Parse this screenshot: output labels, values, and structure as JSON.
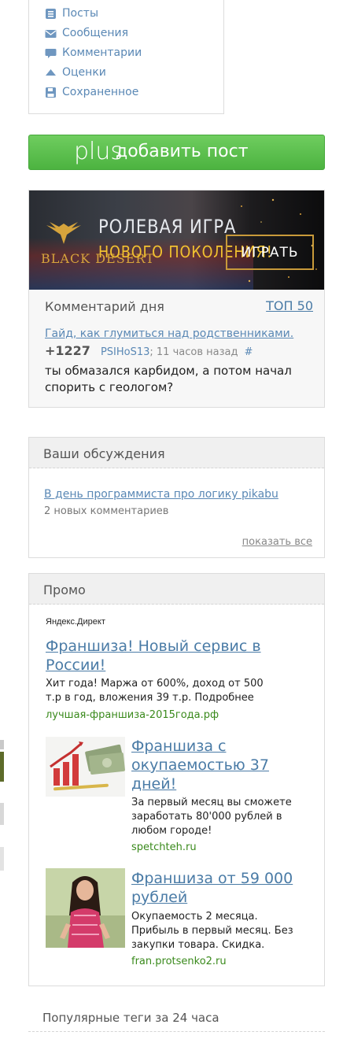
{
  "menu": {
    "items": [
      {
        "label": "Посты",
        "icon": "posts-icon"
      },
      {
        "label": "Сообщения",
        "icon": "envelope-icon"
      },
      {
        "label": "Комментарии",
        "icon": "comment-icon"
      },
      {
        "label": "Оценки",
        "icon": "rating-icon"
      },
      {
        "label": "Сохраненное",
        "icon": "save-icon"
      }
    ]
  },
  "add_post": {
    "icon": "plus",
    "label": "добавить пост"
  },
  "banner": {
    "logo": "BLACK DESERT",
    "line1": "РОЛЕВАЯ ИГРА",
    "line2": "НОВОГО ПОКОЛЕНИЯ!",
    "button": "ИГРАТЬ"
  },
  "comment_of_day": {
    "title": "Комментарий дня",
    "top_link": "ТОП 50",
    "post_link": "Гайд, как глумиться над родственниками.",
    "rating": "+1227",
    "author": "PSIHoS13",
    "time": "11 часов назад",
    "anchor": "#",
    "text": "ты обмазался карбидом, а потом начал спорить с геологом?"
  },
  "discussions": {
    "title": "Ваши обсуждения",
    "link": "В день программиста про логику pikabu",
    "count": "2 новых комментариев",
    "show_all": "показать все"
  },
  "promo": {
    "title": "Промо",
    "provider": "Яндекс.Директ",
    "ads": [
      {
        "title": "Франшиза! Новый сервис в России!",
        "text": "Хит года! Маржа от 600%, доход от 500 т.р в год, вложения 39 т.р. Подробнее",
        "url": "лучшая-франшиза-2015года.рф"
      },
      {
        "title": "Франшиза с окупаемостью 37 дней!",
        "text": "За первый месяц вы сможете заработать 80'000 рублей в любом городе!",
        "url": "spetchteh.ru"
      },
      {
        "title": "Франшиза от 59 000 рублей",
        "text": "Окупаемость 2 месяца. Прибыль в первый месяц. Без закупки товара. Скидка.",
        "url": "fran.protsenko2.ru"
      }
    ]
  },
  "popular_tags": {
    "title": "Популярные теги за 24 часа"
  },
  "colors": {
    "accent_green": "#4cb340",
    "link_blue": "#4a7ba6",
    "url_green": "#3a8a1c"
  }
}
